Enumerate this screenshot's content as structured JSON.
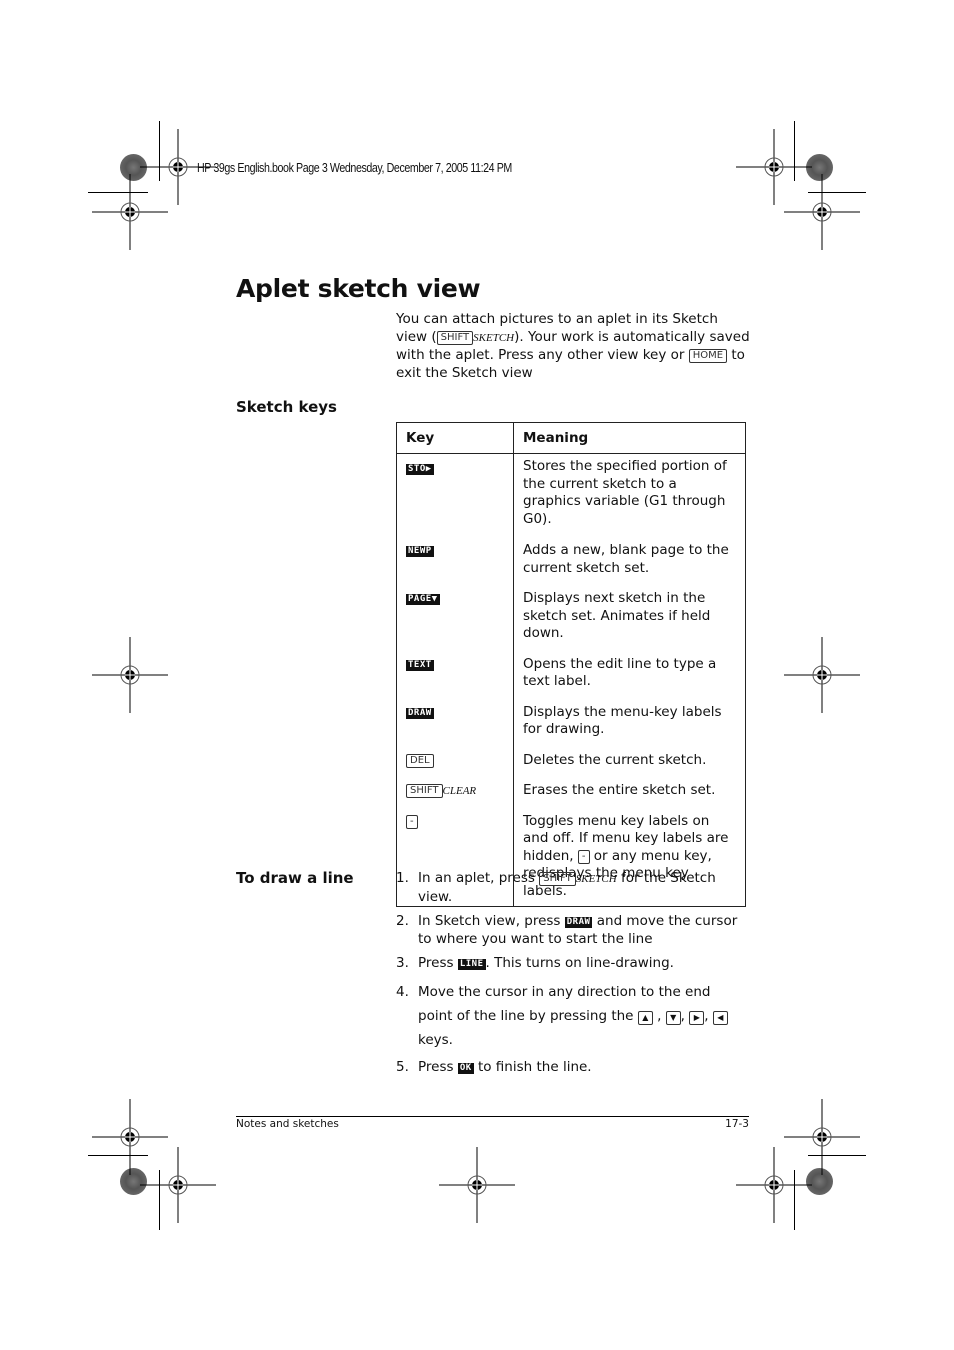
{
  "header": {
    "slug": "HP 39gs English.book  Page 3  Wednesday, December 7, 2005  11:24 PM"
  },
  "page": {
    "title": "Aplet sketch view",
    "intro": {
      "part1": "You can attach pictures to an aplet in its Sketch view (",
      "key_shift": "SHIFT",
      "shifted_sketch": "SKETCH",
      "part2": "). Your work is automatically saved with the aplet. Press any other view key or ",
      "key_home": "HOME",
      "part3": " to exit the Sketch view"
    },
    "sketch_keys": {
      "heading": "Sketch keys",
      "columns": [
        "Key",
        "Meaning"
      ],
      "rows": [
        {
          "key": "STO▶",
          "key_type": "softkey",
          "meaning": "Stores the specified portion of the current sketch to a graphics variable (G1 through G0)."
        },
        {
          "key": "NEWP",
          "key_type": "softkey",
          "meaning": "Adds a new, blank page to the current sketch set."
        },
        {
          "key": "PAGE▼",
          "key_type": "softkey",
          "meaning": "Displays next sketch in the sketch set. Animates if held down."
        },
        {
          "key": "TEXT",
          "key_type": "softkey",
          "meaning": "Opens the edit line to type a text label."
        },
        {
          "key": "DRAW",
          "key_type": "softkey",
          "meaning": "Displays the menu-key labels for drawing."
        },
        {
          "key": "DEL",
          "key_type": "hardkey",
          "meaning": "Deletes the current sketch."
        },
        {
          "key": "SHIFT",
          "key_shifted": "CLEAR",
          "key_type": "shifted",
          "meaning": "Erases the entire sketch set."
        },
        {
          "key": "-",
          "key_type": "hardkey",
          "meaning_part1": "Toggles menu key labels on and off. If menu key labels are hidden, ",
          "meaning_key": "-",
          "meaning_part2": " or any menu key, redisplays the menu key labels."
        }
      ]
    },
    "draw_line": {
      "heading": "To draw a line",
      "steps": [
        {
          "num": "1.",
          "a": "In an aplet, press ",
          "key": "SHIFT",
          "shifted": "SKETCH",
          "b": " for the Sketch view."
        },
        {
          "num": "2.",
          "a": "In Sketch view, press ",
          "softkey": "DRAW",
          "b": " and move the cursor to where you want to start the line"
        },
        {
          "num": "3.",
          "a": "Press ",
          "softkey": "LINE",
          "b": ". This turns on line-drawing."
        },
        {
          "num": "4.",
          "a": "Move the cursor in any direction to the end point of the line by pressing the ",
          "arrows": [
            "▲",
            "▼",
            "▶",
            "◀"
          ],
          "b": " keys."
        },
        {
          "num": "5.",
          "a": "Press ",
          "softkey": "OK",
          "b": " to finish the line."
        }
      ]
    }
  },
  "footer": {
    "section": "Notes and sketches",
    "page_number": "17-3"
  }
}
